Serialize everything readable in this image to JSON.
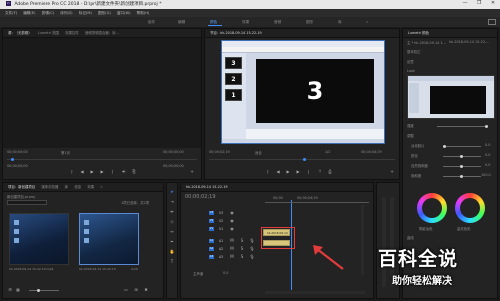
{
  "window": {
    "title": "Adobe Premiere Pro CC 2018 - D:\\pr\\新建文件夹\\新创建项目.prproj *",
    "controls": [
      "—",
      "❐",
      "✕"
    ]
  },
  "menubar": [
    "文件(F)",
    "编辑(E)",
    "剪辑(C)",
    "序列(S)",
    "标记(M)",
    "图形(G)",
    "窗口(W)",
    "帮助(H)"
  ],
  "workspaces": [
    "组件",
    "编辑",
    "颜色",
    "效果",
    "音频",
    "图形",
    "库",
    "»"
  ],
  "active_workspace": "颜色",
  "source_panel": {
    "tabs": [
      "源：（无剪辑）",
      "Lumetri 范围",
      "效果控件",
      "音频剪辑混合器：序..."
    ],
    "timecode_left": "00;00;00;00",
    "page_label": "第1页",
    "timecode_right": "00;00;00;00",
    "sub_left": "00;00;00;00",
    "sub_right": "00;00;00;00"
  },
  "program_panel": {
    "tab": "节目：hk-2018-09-14 15-22-19",
    "timecode_left": "00;00;02;19",
    "fit": "适合",
    "fraction": "1/2",
    "timecode_right": "00;00;04;29",
    "slides": [
      "3",
      "2",
      "1"
    ],
    "main_slide": "3"
  },
  "project_panel": {
    "tabs": [
      "项目：新创建项目",
      "媒体浏览器",
      "库",
      "信息",
      "效果",
      "»"
    ],
    "project_file": "新创建项目.prproj",
    "item_count": "1项已选择，共2项",
    "clips": [
      {
        "name": "hk-2018-09-14 15-22-19.mp4",
        "duration": ""
      },
      {
        "name": "hk-2018-09-14 15-22-19",
        "duration": "4;29"
      }
    ]
  },
  "timeline_panel": {
    "tab": "hk-2018-09-14 15-22-19",
    "timecode": "00;00;02;19",
    "ruler": [
      "00;00",
      "00;00;04;29"
    ],
    "tracks": [
      "V3",
      "V2",
      "V1",
      "A1",
      "A2",
      "A3"
    ],
    "master": "主声道",
    "master_value": "0.0",
    "clip_v": "hk-2018-09-14",
    "clip_a": ""
  },
  "lumetri": {
    "tab": "Lumetri 颜色",
    "master": "主 * hk-2018-09-14 1...",
    "clip_name": "hk-2018-09-14 15-22-...",
    "sections": [
      "基本校正",
      "创意",
      "曲线"
    ],
    "look": "Look",
    "intensity_label": "强度",
    "adjust_label": "调整",
    "sliders": [
      "淡化胶片",
      "锐化",
      "自然饱和度",
      "饱和度"
    ],
    "slider_values": [
      "0.0",
      "0.0",
      "0.0",
      "100.0"
    ],
    "wheel_labels": [
      "阴影淡色",
      "高光色彩"
    ]
  },
  "watermark": {
    "line1": "百科全说",
    "line2": "助你轻松解决"
  },
  "colors": {
    "accent_blue": "#3d8bfd",
    "highlight_red": "#e23b3b",
    "clip_yellow": "#d7c57a"
  }
}
